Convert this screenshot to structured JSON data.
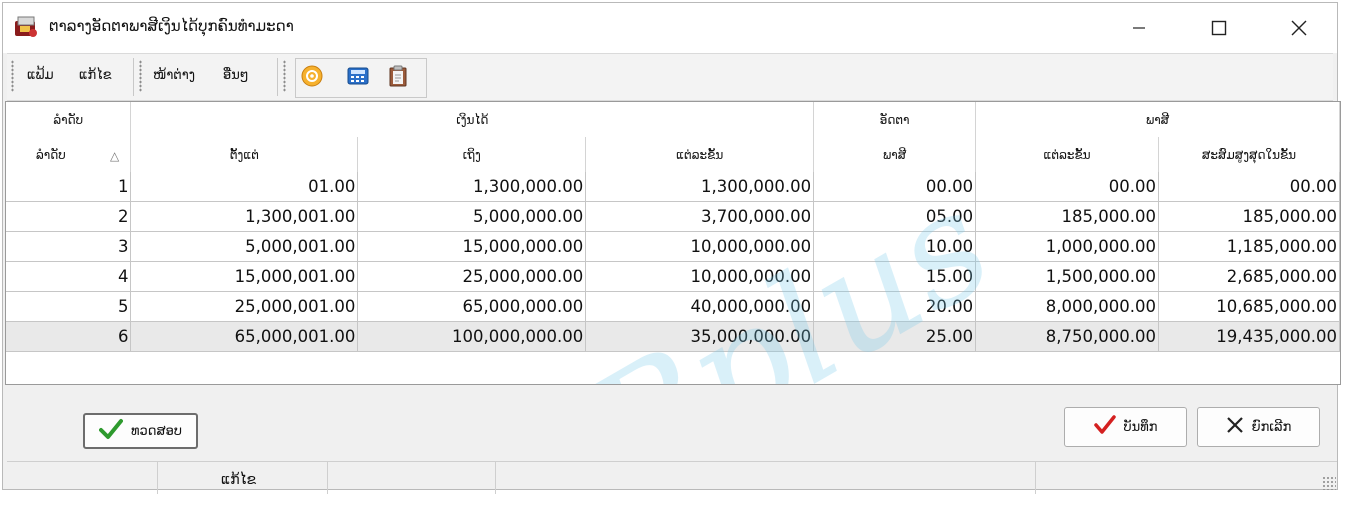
{
  "window": {
    "title": "ຕາລາງອັດຕາພາສີເງິນໄດ້ບຸກຄົນທຳມະດາ",
    "icon": "app-icon"
  },
  "toolbar": {
    "menus": [
      "ແຟ້ມ",
      "ແກ້ໄຂ",
      "ໜ້າຕ່າງ",
      "ອື່ນໆ"
    ],
    "icons": [
      "refresh-icon",
      "calculator-icon",
      "clipboard-icon"
    ]
  },
  "table": {
    "group_headers": {
      "order": "ລຳດັບ",
      "income": "ເງິນໄດ້",
      "rate": "ອັດຕາ",
      "tax": "ພາສີ"
    },
    "columns": [
      "ລຳດັບ",
      "ຕັ້ງແຕ່",
      "ເຖິງ",
      "ແຕ່ລະຂັ້ນ",
      "ພາສີ",
      "ແຕ່ລະຂັ້ນ",
      "ສະສົມສູງສຸດໃນຂັ້ນ"
    ],
    "rows": [
      [
        "1",
        "01.00",
        "1,300,000.00",
        "1,300,000.00",
        "00.00",
        "00.00",
        "00.00"
      ],
      [
        "2",
        "1,300,001.00",
        "5,000,000.00",
        "3,700,000.00",
        "05.00",
        "185,000.00",
        "185,000.00"
      ],
      [
        "3",
        "5,000,001.00",
        "15,000,000.00",
        "10,000,000.00",
        "10.00",
        "1,000,000.00",
        "1,185,000.00"
      ],
      [
        "4",
        "15,000,001.00",
        "25,000,000.00",
        "10,000,000.00",
        "15.00",
        "1,500,000.00",
        "2,685,000.00"
      ],
      [
        "5",
        "25,000,001.00",
        "65,000,000.00",
        "40,000,000.00",
        "20.00",
        "8,000,000.00",
        "10,685,000.00"
      ],
      [
        "6",
        "65,000,001.00",
        "100,000,000.00",
        "35,000,000.00",
        "25.00",
        "8,750,000.00",
        "19,435,000.00"
      ]
    ]
  },
  "watermark": "Bplus",
  "buttons": {
    "confirm": "ທວດສອບ",
    "save": "ບັນທຶກ",
    "cancel": "ຍົກເລີກ"
  },
  "statusbar": {
    "mode": "ແກ້ໄຂ"
  },
  "colors": {
    "check_green": "#2e9a2e",
    "tick_red": "#d42020",
    "watermark": "#78c8eb"
  }
}
